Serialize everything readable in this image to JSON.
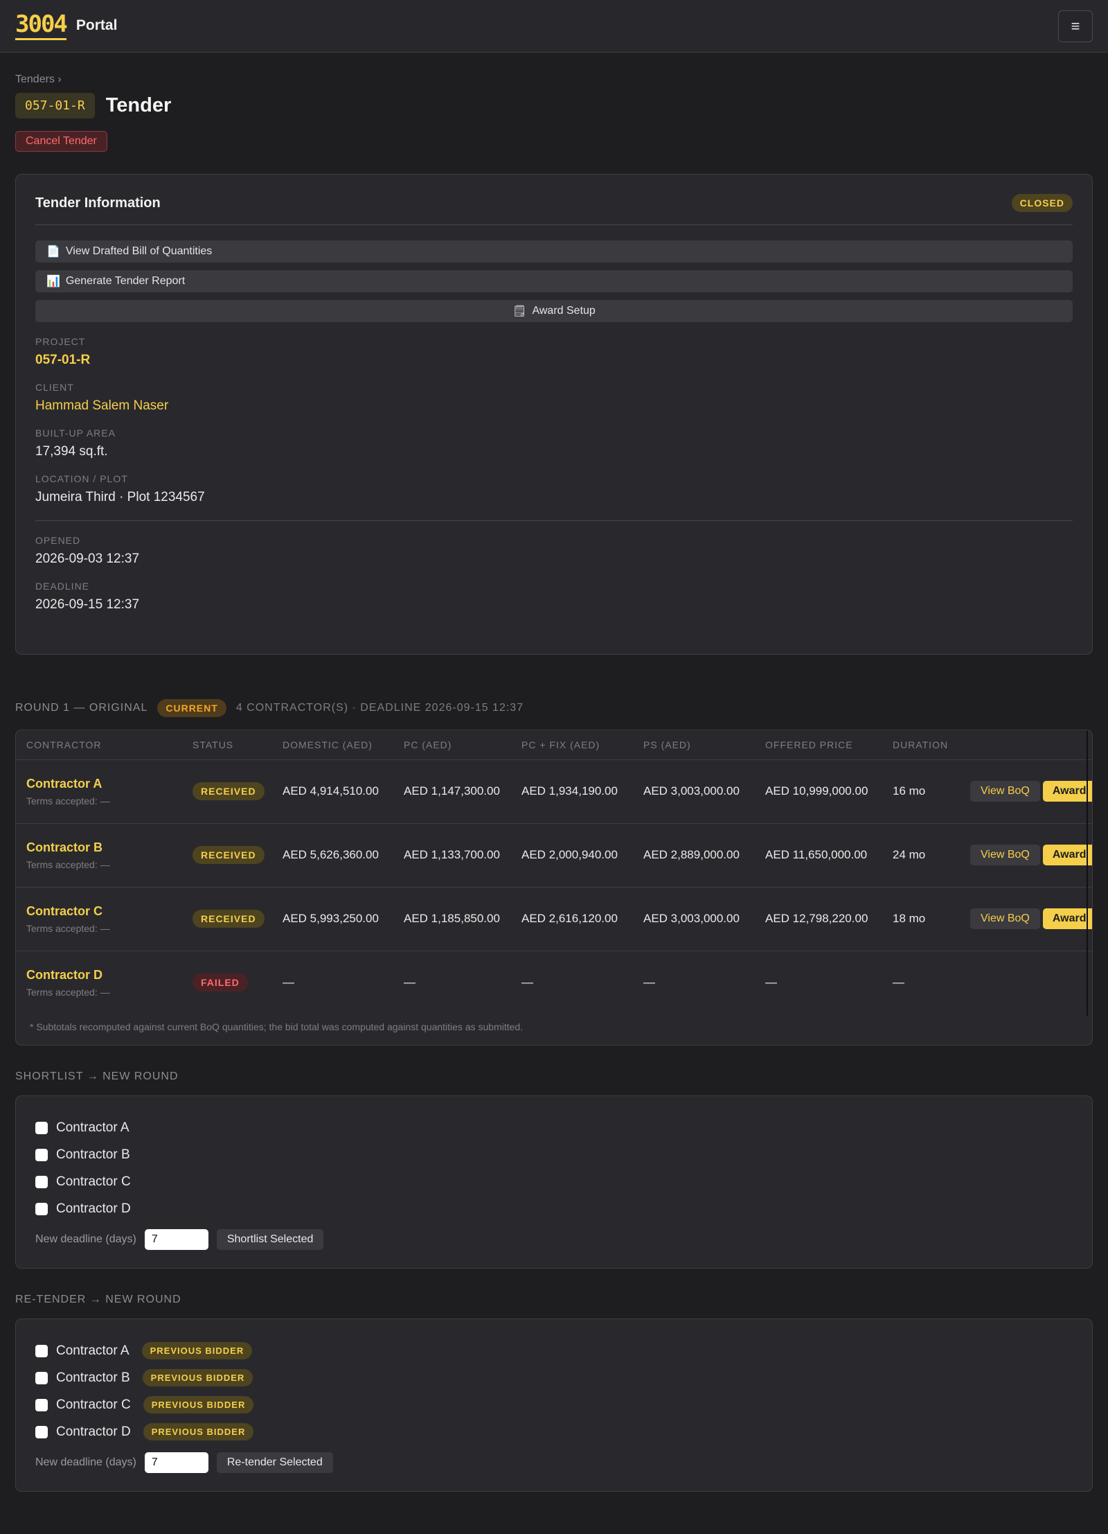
{
  "header": {
    "logo": "3004",
    "portal": "Portal",
    "menu_icon": "hamburger-icon"
  },
  "breadcrumb": "Tenders ›",
  "tender": {
    "code": "057-01-R",
    "title": "Tender",
    "cancel_label": "Cancel Tender"
  },
  "info": {
    "title": "Tender Information",
    "status": "CLOSED",
    "actions": [
      {
        "icon": "📄",
        "label": "View Drafted Bill of Quantities"
      },
      {
        "icon": "📊",
        "label": "Generate Tender Report"
      },
      {
        "icon": "🗒",
        "label": "Award Setup"
      }
    ],
    "project_label": "PROJECT",
    "project": "057-01-R",
    "client_label": "CLIENT",
    "client": "Hammad Salem Naser",
    "area_label": "BUILT-UP AREA",
    "area": "17,394 sq.ft.",
    "location_label": "LOCATION / PLOT",
    "location": "Jumeira Third · Plot 1234567",
    "opened_label": "OPENED",
    "opened": "2026-09-03 12:37",
    "deadline_label": "DEADLINE",
    "deadline": "2026-09-15 12:37"
  },
  "round": {
    "title": "ROUND 1 — ORIGINAL",
    "badge": "CURRENT",
    "meta": "4 CONTRACTOR(S) · DEADLINE 2026-09-15 12:37",
    "columns": [
      "CONTRACTOR",
      "STATUS",
      "DOMESTIC (AED)",
      "PC (AED)",
      "PC + FIX (AED)",
      "PS (AED)",
      "OFFERED PRICE",
      "DURATION"
    ],
    "rows": [
      {
        "name": "Contractor A",
        "terms": "Terms accepted: —",
        "status": "RECEIVED",
        "domestic": "AED 4,914,510.00",
        "pc": "AED 1,147,300.00",
        "pcfix": "AED 1,934,190.00",
        "ps": "AED 3,003,000.00",
        "offered": "AED 10,999,000.00",
        "duration": "16 mo",
        "view": "View BoQ",
        "award": "Award"
      },
      {
        "name": "Contractor B",
        "terms": "Terms accepted: —",
        "status": "RECEIVED",
        "domestic": "AED 5,626,360.00",
        "pc": "AED 1,133,700.00",
        "pcfix": "AED 2,000,940.00",
        "ps": "AED 2,889,000.00",
        "offered": "AED 11,650,000.00",
        "duration": "24 mo",
        "view": "View BoQ",
        "award": "Award"
      },
      {
        "name": "Contractor C",
        "terms": "Terms accepted: —",
        "status": "RECEIVED",
        "domestic": "AED 5,993,250.00",
        "pc": "AED 1,185,850.00",
        "pcfix": "AED 2,616,120.00",
        "ps": "AED 3,003,000.00",
        "offered": "AED 12,798,220.00",
        "duration": "18 mo",
        "view": "View BoQ",
        "award": "Award"
      },
      {
        "name": "Contractor D",
        "terms": "Terms accepted: —",
        "status": "FAILED",
        "domestic": "—",
        "pc": "—",
        "pcfix": "—",
        "ps": "—",
        "offered": "—",
        "duration": "—"
      }
    ],
    "footnote": "* Subtotals recomputed against current BoQ quantities; the bid total was computed against quantities as submitted."
  },
  "shortlist": {
    "title": "SHORTLIST → NEW ROUND",
    "contractors": [
      "Contractor A",
      "Contractor B",
      "Contractor C",
      "Contractor D"
    ],
    "deadline_label": "New deadline (days)",
    "deadline_value": "7",
    "button": "Shortlist Selected"
  },
  "retender": {
    "title": "RE-TENDER → NEW ROUND",
    "contractors": [
      "Contractor A",
      "Contractor B",
      "Contractor C",
      "Contractor D"
    ],
    "badge": "PREVIOUS BIDDER",
    "deadline_label": "New deadline (days)",
    "deadline_value": "7",
    "button": "Re-tender Selected"
  }
}
